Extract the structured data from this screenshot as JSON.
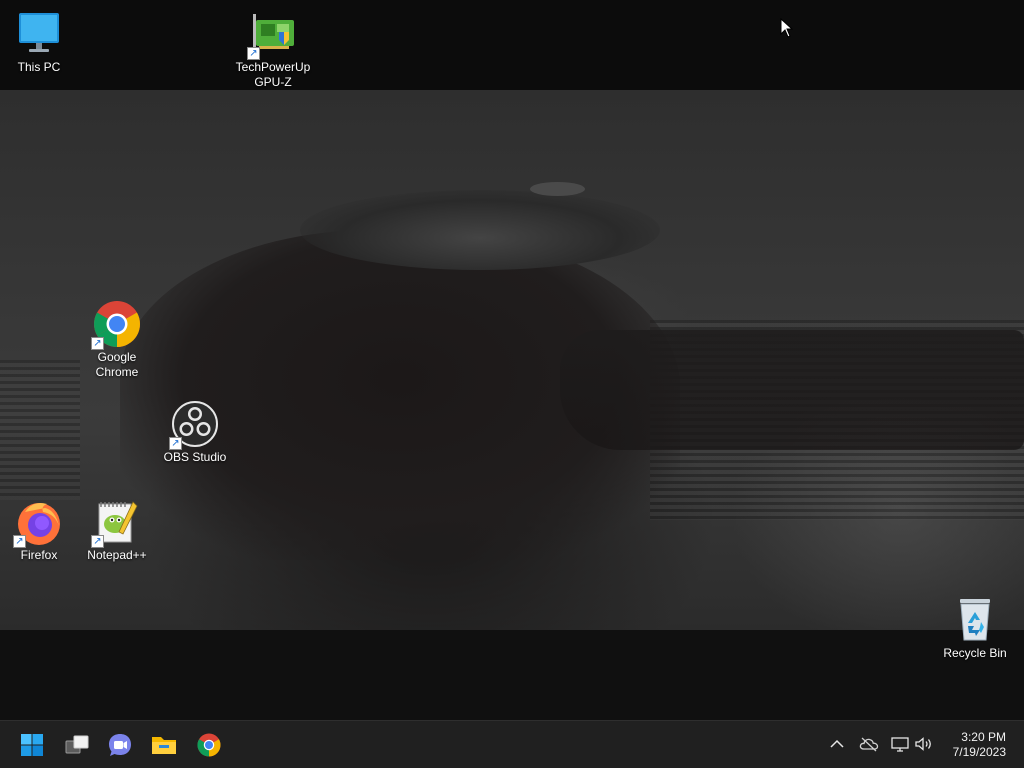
{
  "desktop": {
    "icons": [
      {
        "id": "this-pc",
        "label": "This PC"
      },
      {
        "id": "gpu-z",
        "label": "TechPowerUp\nGPU-Z"
      },
      {
        "id": "google-chrome",
        "label": "Google\nChrome"
      },
      {
        "id": "obs-studio",
        "label": "OBS Studio"
      },
      {
        "id": "firefox",
        "label": "Firefox"
      },
      {
        "id": "notepad-plus-plus",
        "label": "Notepad++"
      },
      {
        "id": "recycle-bin",
        "label": "Recycle Bin"
      }
    ]
  },
  "taskbar": {
    "pinned": [
      {
        "name": "start-button",
        "icon": "windows-logo-icon"
      },
      {
        "name": "task-view-button",
        "icon": "task-view-icon"
      },
      {
        "name": "chat-button",
        "icon": "teams-chat-icon"
      },
      {
        "name": "file-explorer-button",
        "icon": "folder-icon"
      },
      {
        "name": "chrome-button",
        "icon": "chrome-icon"
      }
    ],
    "tray": {
      "icons": [
        "chevron-up-icon",
        "onedrive-offline-icon",
        "network-icon",
        "volume-icon"
      ],
      "time": "3:20 PM",
      "date": "7/19/2023"
    }
  },
  "colors": {
    "taskbar_bg": "#202020",
    "accent_blue": "#0078d4"
  }
}
